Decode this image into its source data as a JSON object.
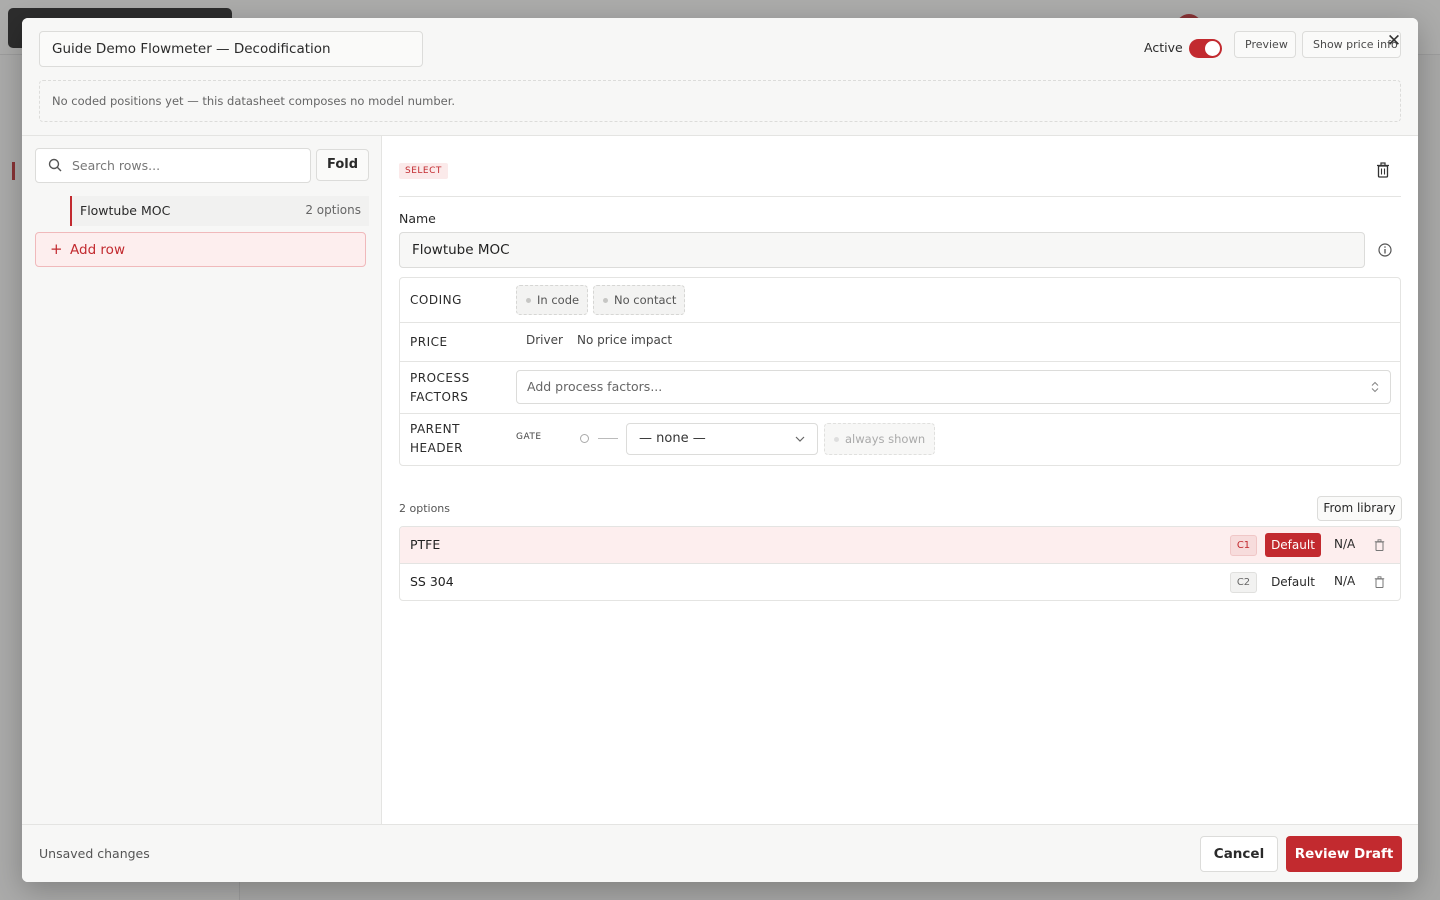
{
  "modal": {
    "title": "Guide Demo Flowmeter — Decodification",
    "active_label": "Active",
    "active": true,
    "preview_label": "Preview",
    "price_info_label": "Show price info",
    "notice": "No coded positions yet — this datasheet composes no model number."
  },
  "sidebar": {
    "search_placeholder": "Search rows...",
    "fold_label": "Fold",
    "rows": [
      {
        "name": "Flowtube MOC",
        "count": "2 options"
      }
    ],
    "add_row_label": "Add row"
  },
  "editor": {
    "type_badge": "SELECT",
    "name_label": "Name",
    "name_value": "Flowtube MOC",
    "props": {
      "coding_label": "CODING",
      "coding_pills": [
        "In code",
        "No contact"
      ],
      "price_label": "PRICE",
      "price_driver": "Driver",
      "price_impact": "No price impact",
      "process_label": "PROCESS FACTORS",
      "process_placeholder": "Add process factors...",
      "parent_label": "PARENT HEADER",
      "gate_label": "GATE",
      "parent_value": "— none —",
      "always_shown": "always shown"
    },
    "options_count": "2 options",
    "from_library_label": "From library",
    "options": [
      {
        "name": "PTFE",
        "code": "C1",
        "default_label": "Default",
        "is_default": true,
        "na": "N/A"
      },
      {
        "name": "SS 304",
        "code": "C2",
        "default_label": "Default",
        "is_default": false,
        "na": "N/A"
      }
    ]
  },
  "footer": {
    "status": "Unsaved changes",
    "cancel_label": "Cancel",
    "review_label": "Review Draft"
  },
  "colors": {
    "accent": "#c22a2f",
    "accent_soft": "#fdeeee"
  }
}
